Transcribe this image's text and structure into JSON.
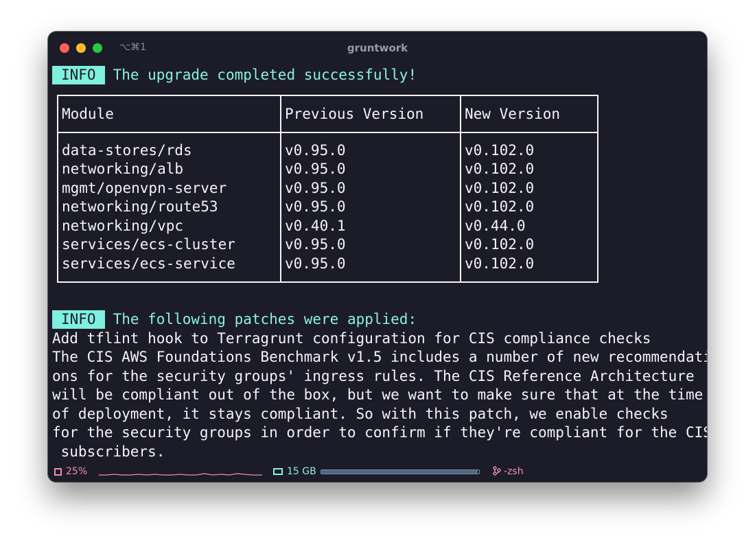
{
  "window": {
    "shortcut": "⌥⌘1",
    "title": "gruntwork"
  },
  "upgrade": {
    "badge": "INFO",
    "message": "The upgrade completed successfully!"
  },
  "table": {
    "headers": [
      "Module",
      "Previous Version",
      "New Version"
    ],
    "rows": [
      [
        "data-stores/rds",
        "v0.95.0",
        "v0.102.0"
      ],
      [
        "networking/alb",
        "v0.95.0",
        "v0.102.0"
      ],
      [
        "mgmt/openvpn-server",
        "v0.95.0",
        "v0.102.0"
      ],
      [
        "networking/route53",
        "v0.95.0",
        "v0.102.0"
      ],
      [
        "networking/vpc",
        "v0.40.1",
        "v0.44.0"
      ],
      [
        "services/ecs-cluster",
        "v0.95.0",
        "v0.102.0"
      ],
      [
        "services/ecs-service",
        "v0.95.0",
        "v0.102.0"
      ]
    ]
  },
  "patches": {
    "badge": "INFO",
    "message": "The following patches were applied:",
    "lines": [
      "Add tflint hook to Terragrunt configuration for CIS compliance checks",
      "The CIS AWS Foundations Benchmark v1.5 includes a number of new recommendati",
      "ons for the security groups' ingress rules. The CIS Reference Architecture",
      "will be compliant out of the box, but we want to make sure that at the time",
      "of deployment, it stays compliant. So with this patch, we enable checks",
      "for the security groups in order to confirm if they're compliant for the CIS",
      " subscribers."
    ]
  },
  "status": {
    "cpu": "25%",
    "memory": "15 GB",
    "memory_fraction": 0.99,
    "shell": "-zsh",
    "cpu_icon": "cpu-icon",
    "memory_icon": "memory-icon",
    "shell_icon": "git-branch-icon",
    "accent_pink": "#f08fa6",
    "accent_teal": "#8af2e2"
  }
}
